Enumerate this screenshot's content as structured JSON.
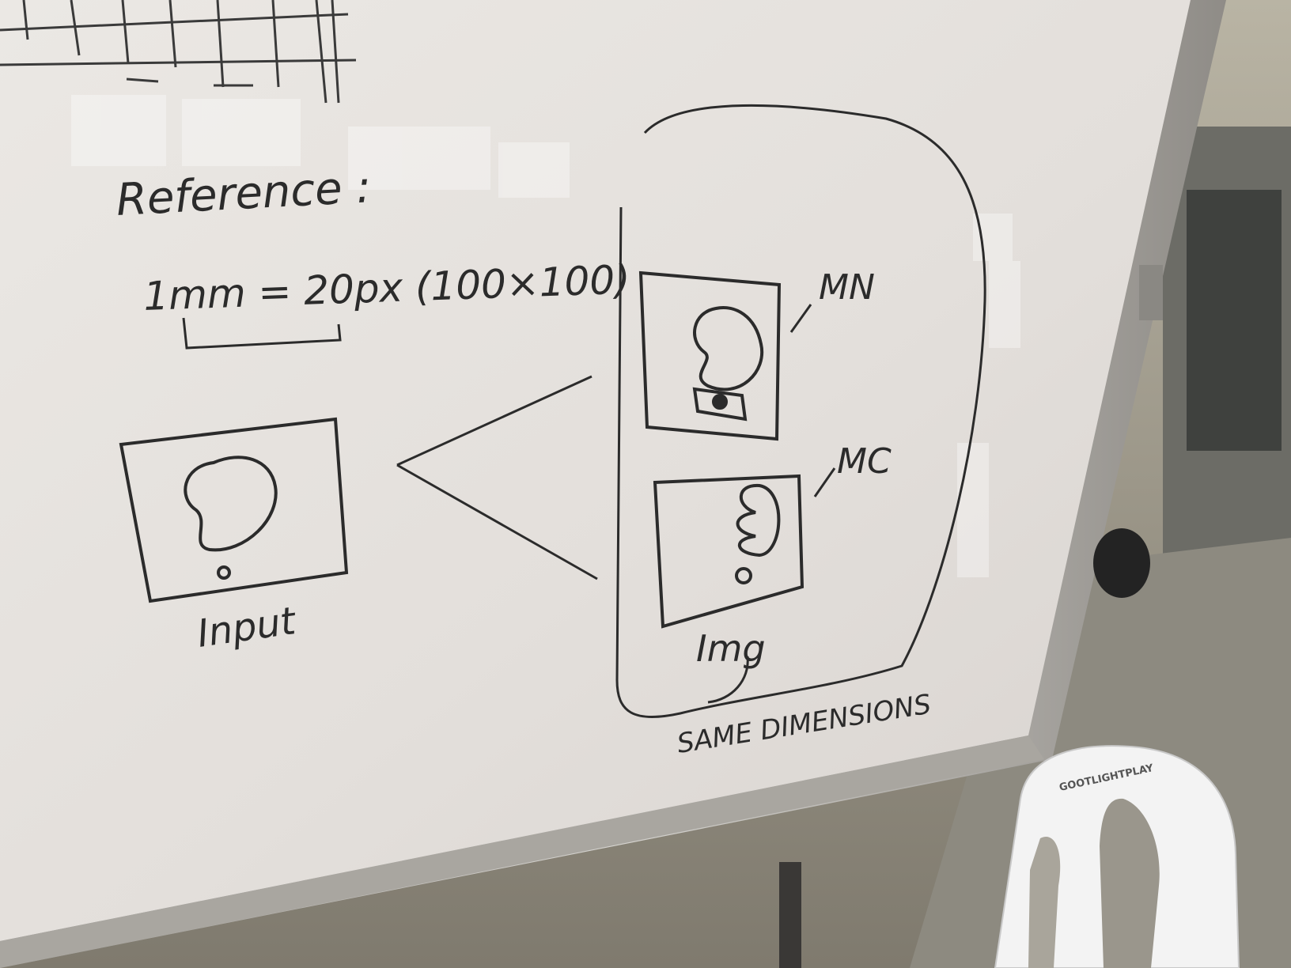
{
  "scene": {
    "colors": {
      "board": "#e7e3de",
      "marker": "#2b2b2b",
      "frame": "#b9b6b1",
      "floor": "#8c877b",
      "chair": "#f2f2f2"
    }
  },
  "whiteboard": {
    "reference_label": "Reference :",
    "scale_note": "1mm = 20px (100×100)",
    "input_label": "Input",
    "mn_label": "MN",
    "mc_label": "MC",
    "img_label": "Img",
    "group_label": "SAME DIMENSIONS"
  },
  "chair": {
    "brand": "GOOTLIGHTPLAY"
  }
}
